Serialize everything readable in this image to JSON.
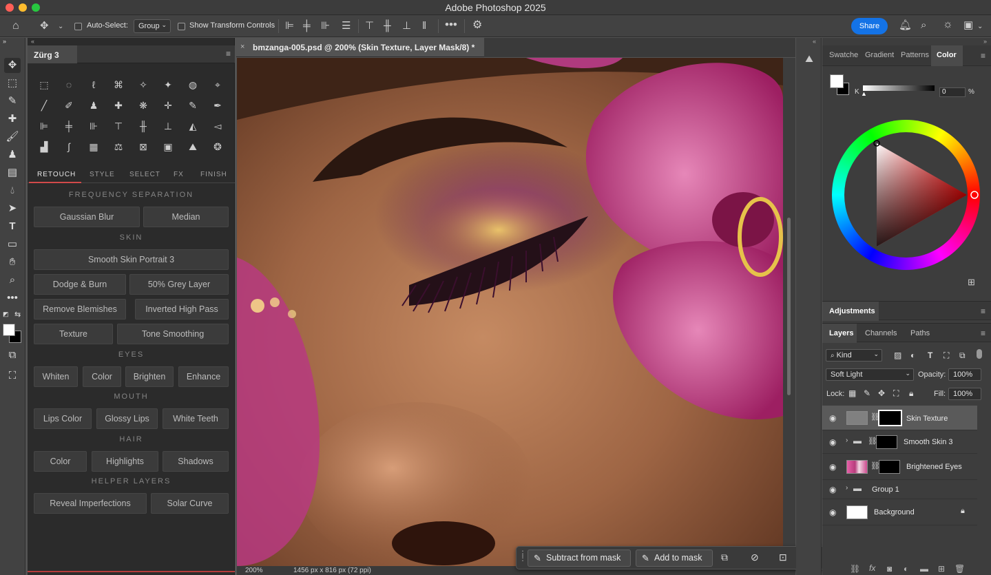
{
  "window": {
    "title": "Adobe Photoshop 2025"
  },
  "options_bar": {
    "auto_select_label": "Auto-Select:",
    "auto_select_value": "Group",
    "show_transform_label": "Show Transform Controls",
    "share_label": "Share"
  },
  "left_panel": {
    "tab_title": "Zürg 3",
    "tabs": [
      "RETOUCH",
      "STYLE",
      "SELECT",
      "FX",
      "FINISH"
    ],
    "sections": {
      "frequency": "FREQUENCY SEPARATION",
      "skin": "SKIN",
      "eyes": "EYES",
      "mouth": "MOUTH",
      "hair": "HAIR",
      "helper": "HELPER LAYERS"
    },
    "buttons": {
      "gaussian_blur": "Gaussian Blur",
      "median": "Median",
      "smooth_skin": "Smooth Skin Portrait 3",
      "dodge_burn": "Dodge & Burn",
      "grey_layer": "50% Grey Layer",
      "remove_blemishes": "Remove Blemishes",
      "inverted_high_pass": "Inverted High Pass",
      "texture": "Texture",
      "tone_smoothing": "Tone Smoothing",
      "whiten": "Whiten",
      "eyes_color": "Color",
      "brighten": "Brighten",
      "enhance": "Enhance",
      "lips_color": "Lips Color",
      "glossy_lips": "Glossy Lips",
      "white_teeth": "White Teeth",
      "hair_color": "Color",
      "highlights": "Highlights",
      "shadows": "Shadows",
      "reveal_imperfections": "Reveal Imperfections",
      "solar_curve": "Solar Curve"
    }
  },
  "document": {
    "tab_label": "bmzanga-005.psd @ 200% (Skin Texture, Layer Mask/8) *",
    "zoom": "200%",
    "dimensions": "1456 px x 816 px (72 ppi)"
  },
  "task_bar": {
    "subtract": "Subtract from mask",
    "add": "Add to mask"
  },
  "color_panel": {
    "tabs": [
      "Swatche",
      "Gradient",
      "Patterns",
      "Color"
    ],
    "active_tab": "Color",
    "channel_label": "K",
    "channel_value": "0",
    "channel_unit": "%"
  },
  "adjustments_panel": {
    "title": "Adjustments"
  },
  "layers_panel": {
    "tabs": [
      "Layers",
      "Channels",
      "Paths"
    ],
    "filter_kind": "Kind",
    "blend_mode": "Soft Light",
    "opacity_label": "Opacity:",
    "opacity_value": "100%",
    "lock_label": "Lock:",
    "fill_label": "Fill:",
    "fill_value": "100%",
    "layers": [
      {
        "name": "Skin Texture"
      },
      {
        "name": "Smooth Skin 3"
      },
      {
        "name": "Brightened Eyes"
      },
      {
        "name": "Group 1"
      },
      {
        "name": "Background"
      }
    ]
  },
  "colors": {
    "accent_blue": "#1473e6",
    "retouch_tab_underline": "#d24a4a"
  }
}
